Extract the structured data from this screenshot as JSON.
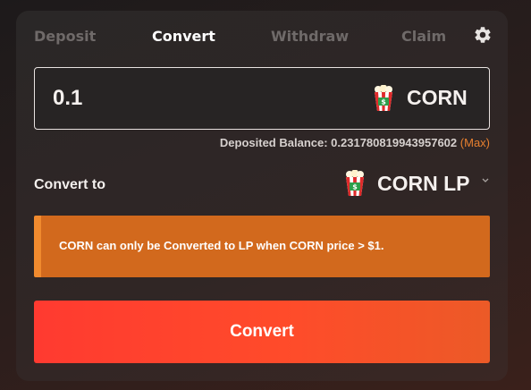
{
  "tabs": [
    {
      "label": "Deposit",
      "active": false
    },
    {
      "label": "Convert",
      "active": true
    },
    {
      "label": "Withdraw",
      "active": false
    },
    {
      "label": "Claim",
      "active": false
    }
  ],
  "settings_icon": "gear-icon",
  "amount_input": {
    "value": "0.1",
    "token": "CORN",
    "token_icon": "popcorn-icon"
  },
  "balance": {
    "label": "Deposited Balance: 0.231780819943957602",
    "max_label": "(Max)"
  },
  "convert_to": {
    "label": "Convert to",
    "token": "CORN LP",
    "token_icon": "popcorn-icon",
    "chevron_icon": "chevron-down-icon"
  },
  "warning": {
    "text": "CORN can only be Converted to LP when CORN price > $1."
  },
  "convert_button": {
    "label": "Convert"
  },
  "colors": {
    "accent": "#e8802f",
    "warning_bg": "#d2691d",
    "button": "#ff3a30",
    "active_tab": "#ffffff",
    "inactive_tab": "#6f6a69"
  }
}
